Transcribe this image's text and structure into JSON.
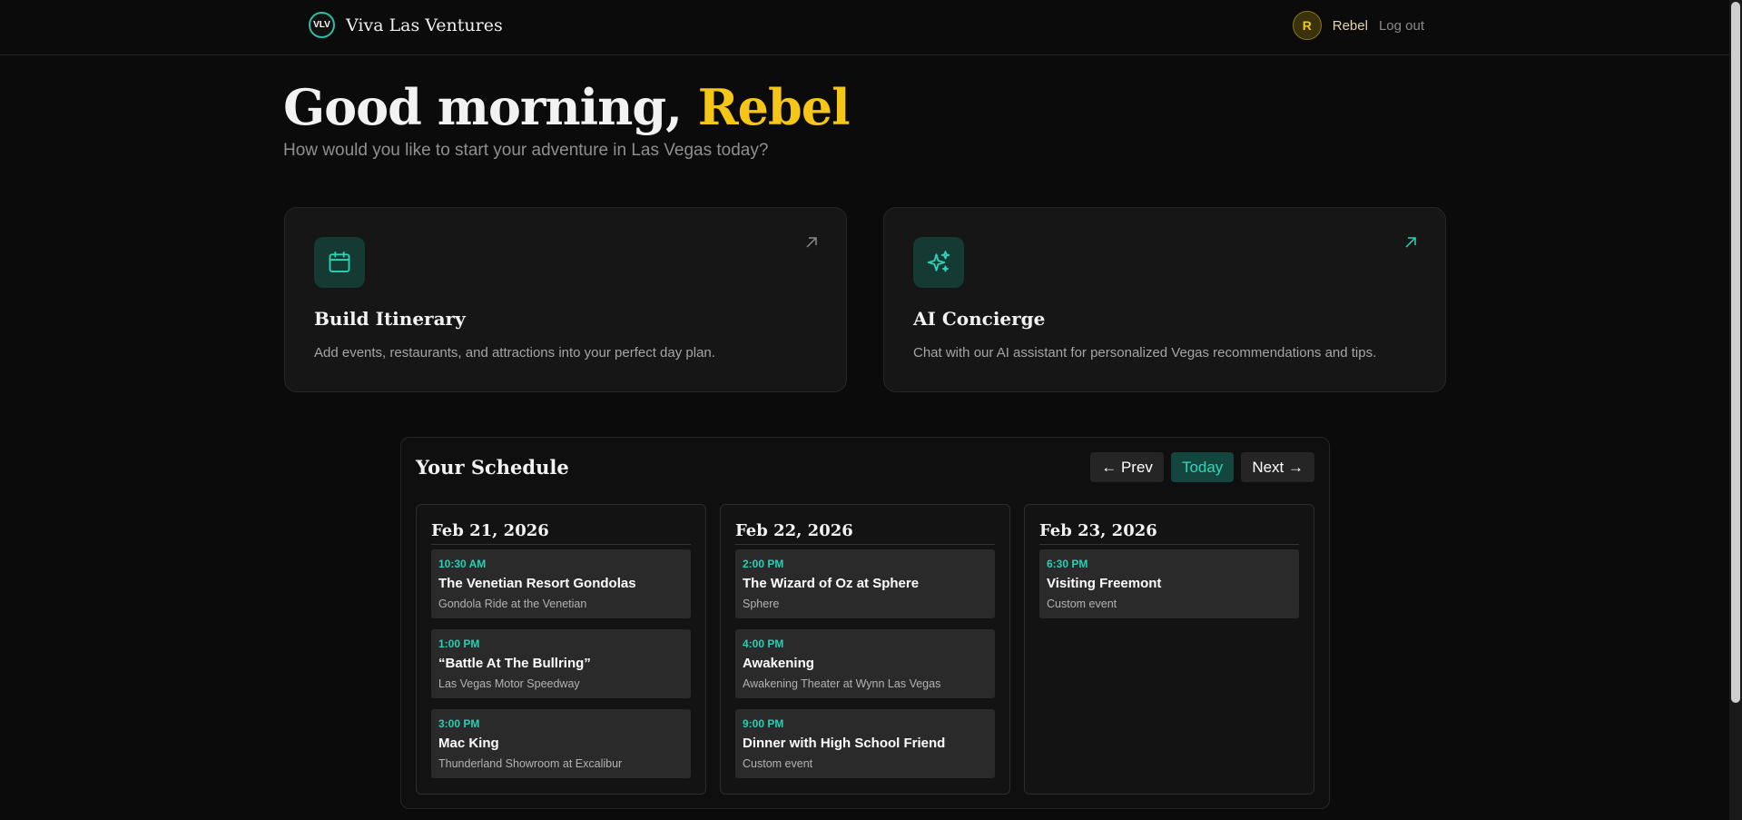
{
  "header": {
    "logo_text": "VLV",
    "brand": "Viva Las Ventures",
    "avatar_initial": "R",
    "username": "Rebel",
    "logout": "Log out"
  },
  "greeting": {
    "prefix": "Good morning,",
    "name": "Rebel",
    "subtitle": "How would you like to start your adventure in Las Vegas today?"
  },
  "cards": [
    {
      "icon": "calendar-icon",
      "title": "Build Itinerary",
      "description": "Add events, restaurants, and attractions into your perfect day plan."
    },
    {
      "icon": "sparkles-icon",
      "title": "AI Concierge",
      "description": "Chat with our AI assistant for personalized Vegas recommendations and tips."
    }
  ],
  "schedule": {
    "title": "Your Schedule",
    "prev": "← Prev",
    "today": "Today",
    "next": "Next →",
    "days": [
      {
        "date": "Feb 21, 2026",
        "events": [
          {
            "time": "10:30 AM",
            "name": "The Venetian Resort Gondolas",
            "venue": "Gondola Ride at the Venetian"
          },
          {
            "time": "1:00 PM",
            "name": "“Battle At The Bullring”",
            "venue": "Las Vegas Motor Speedway"
          },
          {
            "time": "3:00 PM",
            "name": "Mac King",
            "venue": "Thunderland Showroom at Excalibur"
          }
        ]
      },
      {
        "date": "Feb 22, 2026",
        "events": [
          {
            "time": "2:00 PM",
            "name": "The Wizard of Oz at Sphere",
            "venue": "Sphere"
          },
          {
            "time": "4:00 PM",
            "name": "Awakening",
            "venue": "Awakening Theater at Wynn Las Vegas"
          },
          {
            "time": "9:00 PM",
            "name": "Dinner with High School Friend",
            "venue": "Custom event"
          }
        ]
      },
      {
        "date": "Feb 23, 2026",
        "events": [
          {
            "time": "6:30 PM",
            "name": "Visiting Freemont",
            "venue": "Custom event"
          }
        ]
      }
    ]
  },
  "colors": {
    "accent_gold": "#f5c518",
    "accent_teal": "#25d0b5",
    "background": "#0b0b0b"
  }
}
